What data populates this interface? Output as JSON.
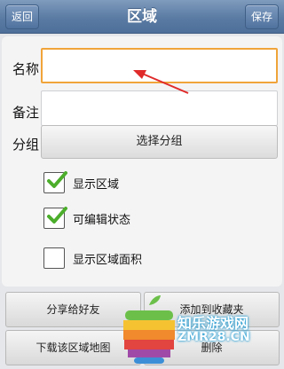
{
  "header": {
    "title": "区域",
    "back_label": "返回",
    "save_label": "保存"
  },
  "form": {
    "name_label": "名称",
    "name_value": "",
    "note_label": "备注",
    "note_value": "",
    "group_label": "分组",
    "group_button": "选择分组",
    "options": [
      {
        "label": "显示区域",
        "checked": true
      },
      {
        "label": "可编辑状态",
        "checked": true
      },
      {
        "label": "显示区域面积",
        "checked": false
      }
    ]
  },
  "actions": {
    "share": "分享给好友",
    "favorite": "添加到收藏夹",
    "download": "下载该区域地图",
    "delete": "删除"
  },
  "colors": {
    "accent_check": "#4cae2b",
    "focus_border": "#f0a43a",
    "arrow": "#e02a2a"
  },
  "watermark": {
    "text": "知乐游戏网",
    "subtext": "ZMR28.CN"
  }
}
